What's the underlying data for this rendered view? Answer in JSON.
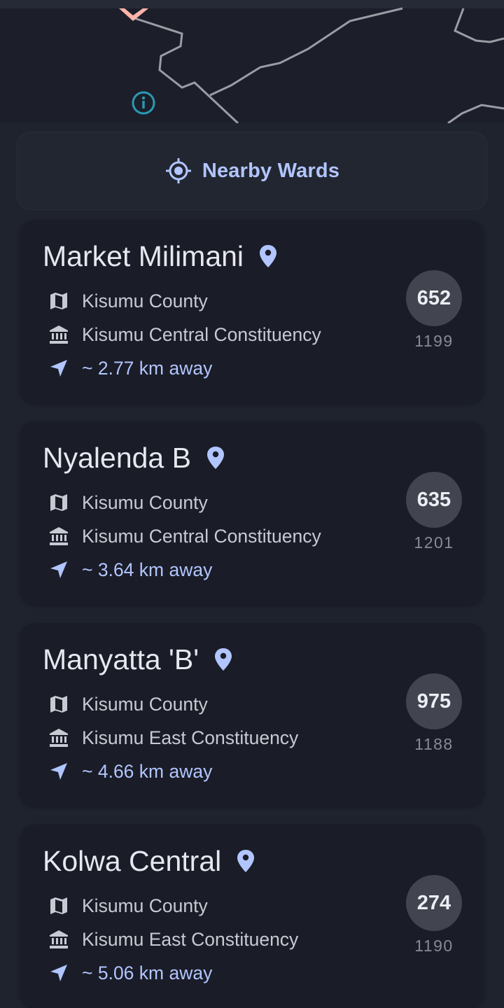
{
  "map": {
    "info_icon": "info-icon",
    "line_color": "#9b9ca4",
    "marker_color": "#ffb4ab"
  },
  "nearby": {
    "label": "Nearby Wards",
    "icon": "gps-crosshair-icon",
    "accent": "#b1c5ff"
  },
  "wards": [
    {
      "name": "Market Milimani",
      "county": "Kisumu County",
      "constituency": "Kisumu Central Constituency",
      "distance": "~ 2.77 km away",
      "count": "652",
      "total": "1199"
    },
    {
      "name": "Nyalenda B",
      "county": "Kisumu County",
      "constituency": "Kisumu Central Constituency",
      "distance": "~ 3.64 km away",
      "count": "635",
      "total": "1201"
    },
    {
      "name": "Manyatta 'B'",
      "county": "Kisumu County",
      "constituency": "Kisumu East Constituency",
      "distance": "~ 4.66 km away",
      "count": "975",
      "total": "1188"
    },
    {
      "name": "Kolwa Central",
      "county": "Kisumu County",
      "constituency": "Kisumu East Constituency",
      "distance": "~ 5.06 km away",
      "count": "274",
      "total": "1190"
    }
  ]
}
